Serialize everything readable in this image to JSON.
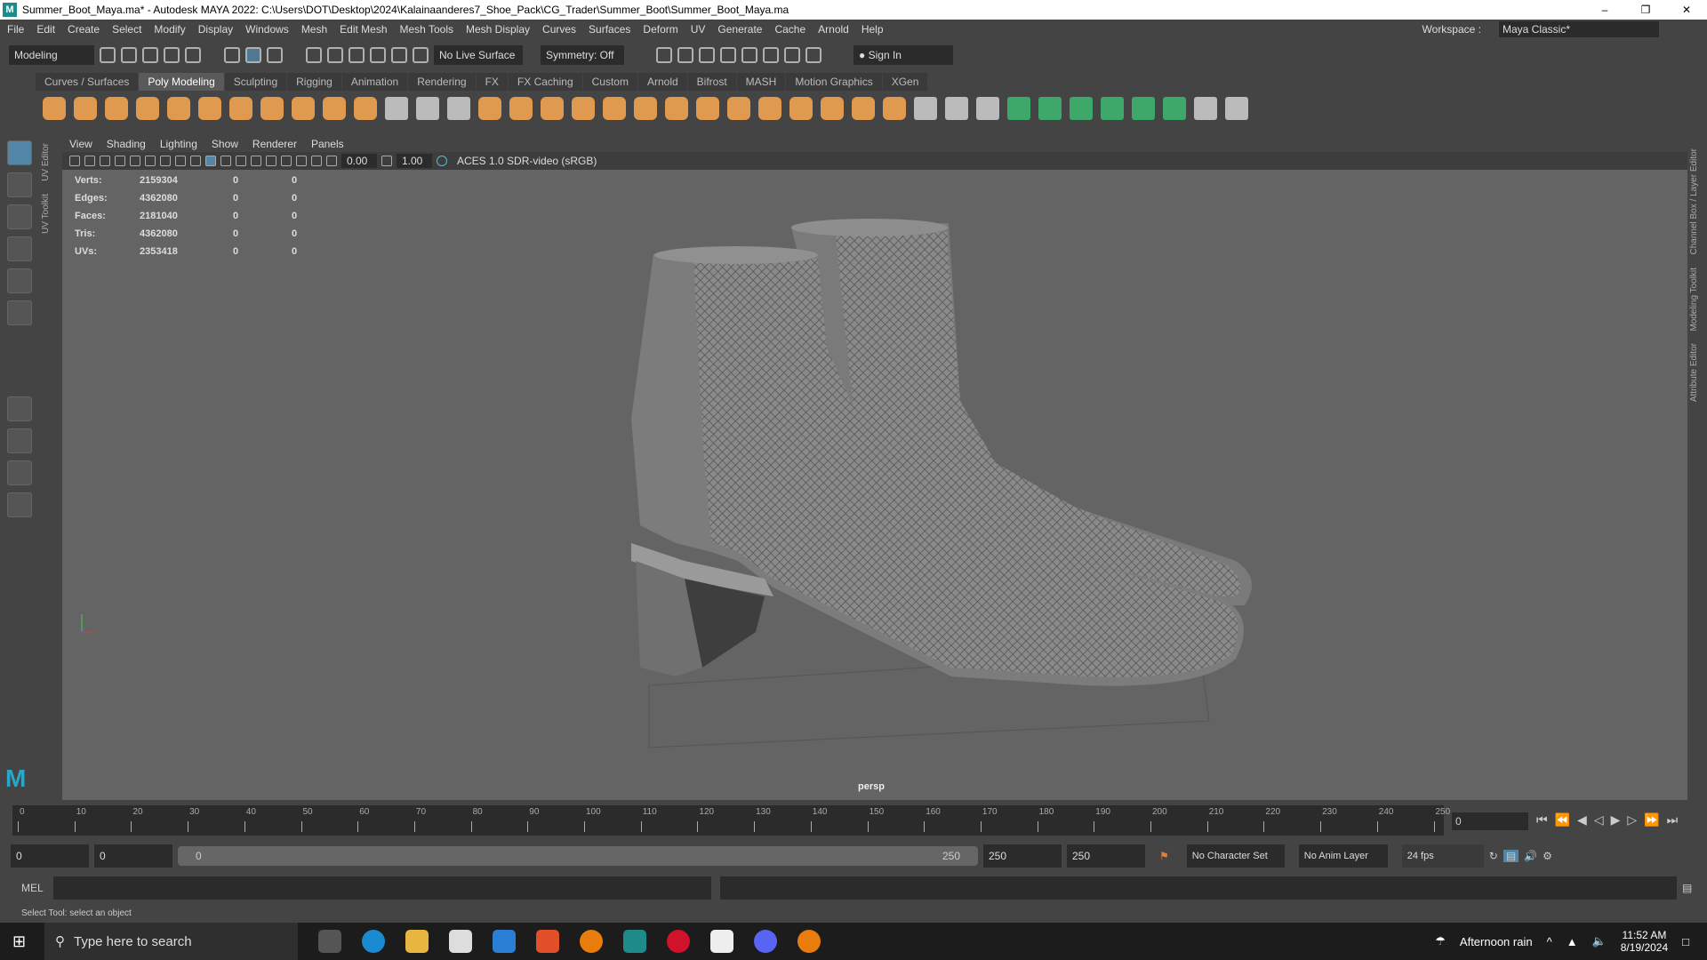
{
  "title": "Summer_Boot_Maya.ma* - Autodesk MAYA 2022: C:\\Users\\DOT\\Desktop\\2024\\Kalainaanderes7_Shoe_Pack\\CG_Trader\\Summer_Boot\\Summer_Boot_Maya.ma",
  "menus": [
    "File",
    "Edit",
    "Create",
    "Select",
    "Modify",
    "Display",
    "Windows",
    "Mesh",
    "Edit Mesh",
    "Mesh Tools",
    "Mesh Display",
    "Curves",
    "Surfaces",
    "Deform",
    "UV",
    "Generate",
    "Cache",
    "Arnold",
    "Help"
  ],
  "workspace": {
    "label": "Workspace :",
    "value": "Maya Classic*"
  },
  "toolbar": {
    "mode": "Modeling",
    "live_surface": "No Live Surface",
    "symmetry": "Symmetry: Off",
    "sign_in": "Sign In"
  },
  "shelf_tabs": [
    "Curves / Surfaces",
    "Poly Modeling",
    "Sculpting",
    "Rigging",
    "Animation",
    "Rendering",
    "FX",
    "FX Caching",
    "Custom",
    "Arnold",
    "Bifrost",
    "MASH",
    "Motion Graphics",
    "XGen"
  ],
  "viewport": {
    "menus": [
      "View",
      "Shading",
      "Lighting",
      "Show",
      "Renderer",
      "Panels"
    ],
    "exposure": "0.00",
    "gamma": "1.00",
    "color_space": "ACES 1.0 SDR-video (sRGB)",
    "camera": "persp",
    "stats": [
      {
        "label": "Verts:",
        "value": "2159304",
        "a": "0",
        "b": "0"
      },
      {
        "label": "Edges:",
        "value": "4362080",
        "a": "0",
        "b": "0"
      },
      {
        "label": "Faces:",
        "value": "2181040",
        "a": "0",
        "b": "0"
      },
      {
        "label": "Tris:",
        "value": "4362080",
        "a": "0",
        "b": "0"
      },
      {
        "label": "UVs:",
        "value": "2353418",
        "a": "0",
        "b": "0"
      }
    ]
  },
  "side_tabs_left": [
    "UV Editor",
    "UV Toolkit"
  ],
  "side_tabs_right": [
    "Channel Box / Layer Editor",
    "Modeling Toolkit",
    "Attribute Editor"
  ],
  "timeline": {
    "ticks": [
      "0",
      "10",
      "20",
      "30",
      "40",
      "50",
      "60",
      "70",
      "80",
      "90",
      "100",
      "110",
      "120",
      "130",
      "140",
      "150",
      "160",
      "170",
      "180",
      "190",
      "200",
      "210",
      "220",
      "230",
      "240",
      "250"
    ],
    "current_frame": "0"
  },
  "range": {
    "start": "0",
    "anim_start": "0",
    "bar_start": "0",
    "bar_end": "250",
    "anim_end": "250",
    "end": "250",
    "character_set": "No Character Set",
    "anim_layer": "No Anim Layer",
    "fps": "24 fps"
  },
  "mel": {
    "label": "MEL"
  },
  "help_line": "Select Tool: select an object",
  "taskbar": {
    "search_placeholder": "Type here to search",
    "weather": "Afternoon rain",
    "time": "11:52 AM",
    "date": "8/19/2024"
  }
}
